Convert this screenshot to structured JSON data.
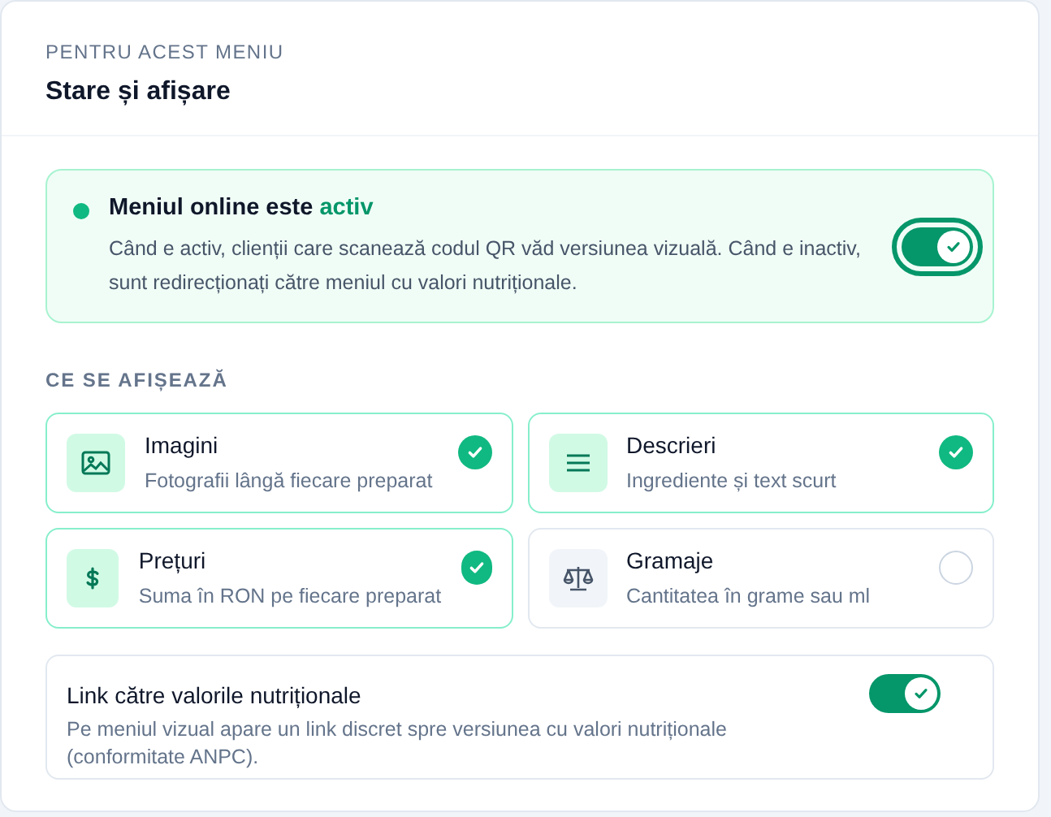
{
  "header": {
    "eyebrow": "PENTRU ACEST MENIU",
    "title": "Stare și afișare"
  },
  "status": {
    "on": true,
    "title": "Meniul online este",
    "state_word": "activ",
    "description": "Când e activ, clienții care scanează codul QR văd versiunea vizuală. Când e inactiv, sunt redirecționați către meniul cu valori nutriționale."
  },
  "section_label": "CE SE AFIȘEAZĂ",
  "options": [
    {
      "title": "Imagini",
      "subtitle": "Fotografii lângă fiecare preparat",
      "checked": true
    },
    {
      "title": "Descrieri",
      "subtitle": "Ingrediente și text scurt",
      "checked": true
    },
    {
      "title": "Prețuri",
      "subtitle": "Suma în RON pe fiecare preparat",
      "checked": true
    },
    {
      "title": "Gramaje",
      "subtitle": "Cantitatea în grame sau ml",
      "checked": false
    }
  ],
  "link_setting": {
    "title": "Link către valorile nutriționale",
    "description": "Pe meniul vizual apare un link discret spre versiunea cu valori nutriționale (conformitate ANPC).",
    "on": true
  }
}
